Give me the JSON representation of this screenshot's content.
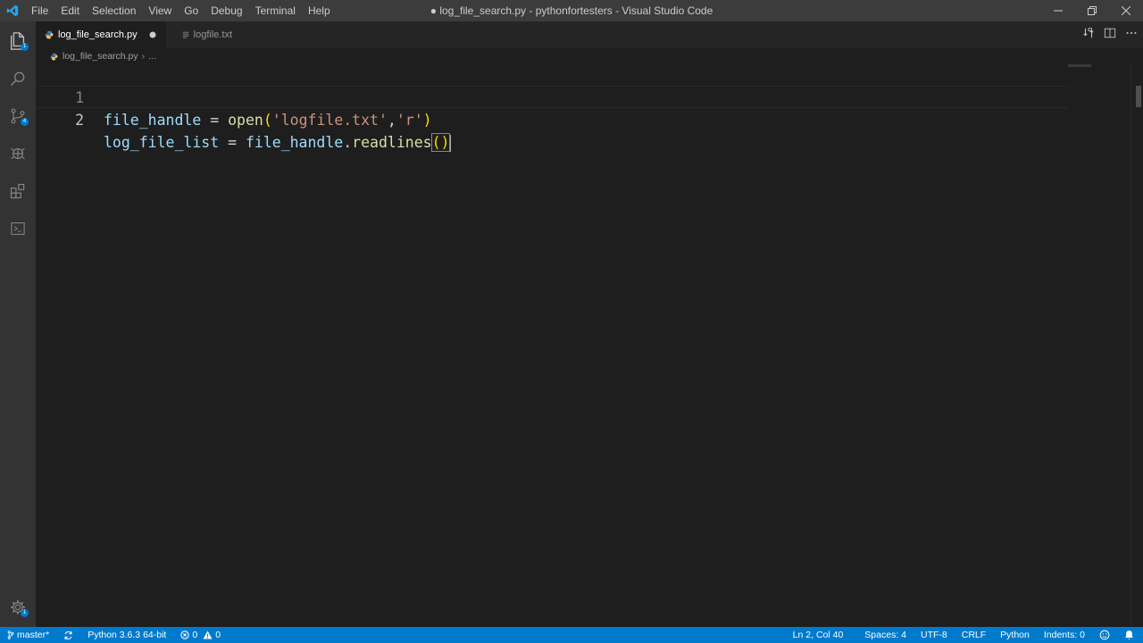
{
  "window": {
    "title": "● log_file_search.py - pythonfortesters - Visual Studio Code",
    "menu": [
      "File",
      "Edit",
      "Selection",
      "View",
      "Go",
      "Debug",
      "Terminal",
      "Help"
    ]
  },
  "activity_bar": {
    "items": [
      {
        "name": "explorer",
        "badge": "1"
      },
      {
        "name": "search"
      },
      {
        "name": "source-control",
        "badge": "4"
      },
      {
        "name": "debug"
      },
      {
        "name": "extensions"
      },
      {
        "name": "remote"
      }
    ],
    "settings_badge": "1"
  },
  "tabs": [
    {
      "label": "log_file_search.py",
      "active": true,
      "dirty": true
    },
    {
      "label": "logfile.txt",
      "active": false,
      "dirty": false
    }
  ],
  "breadcrumb": {
    "file": "log_file_search.py",
    "rest": "..."
  },
  "editor": {
    "lines": [
      {
        "number": "1",
        "tokens": [
          {
            "t": "var",
            "v": "file_handle"
          },
          {
            "t": "op",
            "v": " = "
          },
          {
            "t": "fn",
            "v": "open"
          },
          {
            "t": "paren",
            "v": "("
          },
          {
            "t": "str",
            "v": "'logfile.txt'"
          },
          {
            "t": "op",
            "v": ","
          },
          {
            "t": "str",
            "v": "'r'"
          },
          {
            "t": "paren",
            "v": ")"
          }
        ]
      },
      {
        "number": "2",
        "tokens": [
          {
            "t": "var",
            "v": "log_file_list"
          },
          {
            "t": "op",
            "v": " = "
          },
          {
            "t": "var",
            "v": "file_handle"
          },
          {
            "t": "op",
            "v": "."
          },
          {
            "t": "fn",
            "v": "readlines"
          },
          {
            "t": "paren",
            "v": "()"
          }
        ]
      }
    ],
    "cursor": {
      "line": 2,
      "col": 40
    }
  },
  "status_bar": {
    "branch": "master*",
    "interpreter": "Python 3.6.3 64-bit",
    "errors": "0",
    "warnings": "0",
    "position": "Ln 2, Col 40",
    "spaces": "Spaces: 4",
    "encoding": "UTF-8",
    "eol": "CRLF",
    "language": "Python",
    "indents": "Indents: 0"
  },
  "colors": {
    "titlebar": "#3c3c3c",
    "activitybar": "#333333",
    "editor_bg": "#1e1e1e",
    "statusbar": "#007acc",
    "accent": "#007acc"
  }
}
